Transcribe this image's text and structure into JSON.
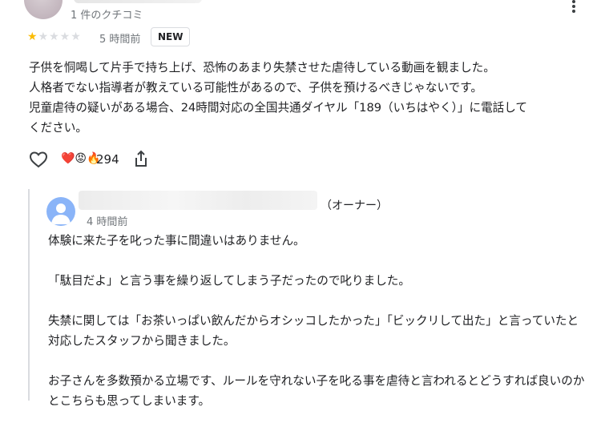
{
  "review": {
    "review_count": "1 件のクチコミ",
    "rating": 1,
    "rating_max": 5,
    "time": "5 時間前",
    "badge": "NEW",
    "text_lines": [
      "子供を恫喝して片手で持ち上げ、恐怖のあまり失禁させた虐待している動画を観ました。",
      "人格者でない指導者が教えている可能性があるので、子供を預けるべきじゃないです。",
      "児童虐待の疑いがある場合、24時間対応の全国共通ダイヤル「189（いちはやく）」に電話して",
      "ください。"
    ],
    "reactions": "❤️😡🔥",
    "like_count": "294",
    "colors": {
      "star": "#fbbc04",
      "star_empty": "#dadce0",
      "heart": "#d93025"
    }
  },
  "owner_reply": {
    "role_suffix": "（オーナー）",
    "time": "4 時間前",
    "paragraphs": [
      "体験に来た子を叱った事に間違いはありません。",
      "「駄目だよ」と言う事を繰り返してしまう子だったので叱りました。",
      "失禁に関しては「お茶いっぱい飲んだからオシッコしたかった」「ビックリして出た」と言っていたと対応したスタッフから聞きました。",
      "お子さんを多数預かる立場です、ルールを守れない子を叱る事を虐待と言われるとどうすれば良いのかとこちらも思ってしまいます。"
    ],
    "colors": {
      "avatar": "#8ab4f8"
    }
  }
}
